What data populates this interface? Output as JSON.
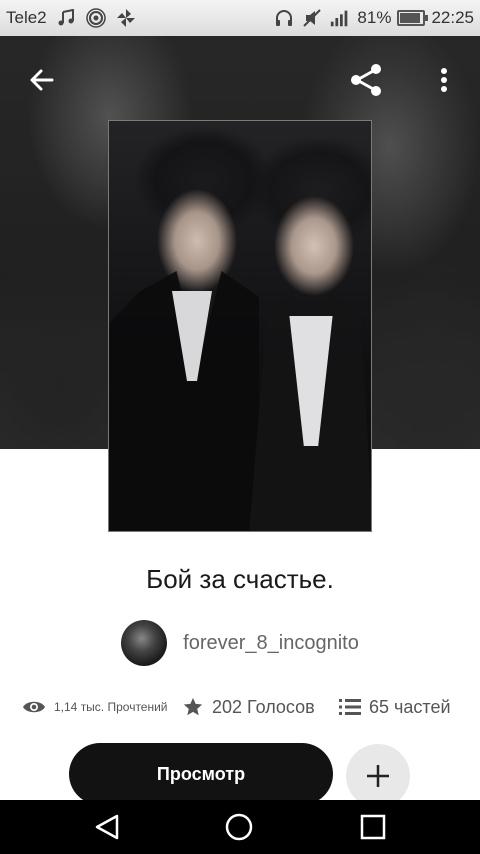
{
  "status_bar": {
    "carrier": "Tele2",
    "battery_percent": "81%",
    "battery_level": 0.81,
    "time": "22:25",
    "icons": [
      "music-icon",
      "hotspot-icon",
      "pinwheel-icon",
      "headphones-icon",
      "mute-icon",
      "signal-icon",
      "battery-icon"
    ]
  },
  "toolbar": {
    "back_icon": "arrow-left-icon",
    "share_icon": "share-icon",
    "menu_icon": "more-vertical-icon"
  },
  "story": {
    "title": "Бой за счастье.",
    "author": "forever_8_incognito",
    "reads": "1,14 тыс. Прочтений",
    "votes": "202 Голосов",
    "parts": "65 частей"
  },
  "actions": {
    "read_label": "Просмотр",
    "add_icon": "plus-icon"
  },
  "nav_bar": {
    "icons": [
      "back-triangle-icon",
      "home-circle-icon",
      "recents-square-icon"
    ]
  }
}
